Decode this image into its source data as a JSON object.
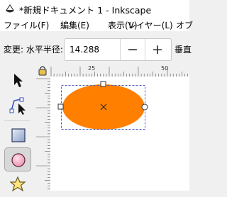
{
  "window": {
    "title": "*新規ドキュメント 1 - Inkscape"
  },
  "menubar": {
    "items": [
      "ファイル(F)",
      "編集(E)",
      "表示(V)",
      "レイヤー(L)",
      "オブ"
    ]
  },
  "toolbar": {
    "label": "変更: 水平半径:",
    "rx_value": "14.288",
    "minus_label": "−",
    "plus_label": "+",
    "next_label": "垂直"
  },
  "rulers": {
    "h_labels": [
      "25",
      "50"
    ]
  },
  "tools": [
    {
      "name": "selector",
      "icon": "arrow-cursor-icon",
      "active": false
    },
    {
      "name": "node",
      "icon": "node-edit-icon",
      "active": false
    },
    {
      "name": "rectangle",
      "icon": "rectangle-icon",
      "active": false
    },
    {
      "name": "ellipse",
      "icon": "ellipse-icon",
      "active": true
    },
    {
      "name": "star",
      "icon": "star-icon",
      "active": false
    }
  ],
  "canvas": {
    "object_type": "ellipse",
    "fill_color": "#ff7f00",
    "selection_color": "#5060c0"
  }
}
